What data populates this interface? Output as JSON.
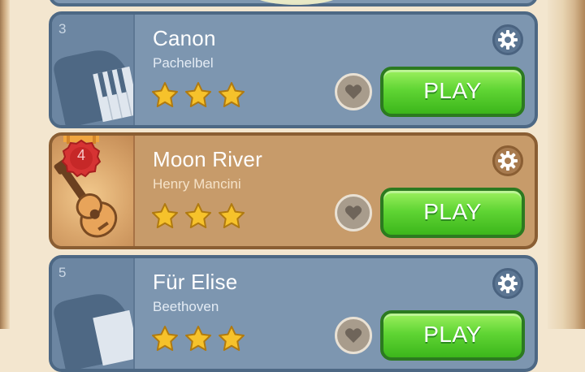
{
  "songs": [
    {
      "rank": "3",
      "title": "Canon",
      "artist": "Pachelbel",
      "stars": 3,
      "play_label": "PLAY",
      "thumb_icon": "piano-icon",
      "theme": "blue"
    },
    {
      "rank": "4",
      "title": "Moon River",
      "artist": "Henry Mancini",
      "stars": 3,
      "play_label": "PLAY",
      "thumb_icon": "guitar-icon",
      "theme": "gold"
    },
    {
      "rank": "5",
      "title": "Für Elise",
      "artist": "Beethoven",
      "stars": 3,
      "play_label": "PLAY",
      "thumb_icon": "piano-icon",
      "theme": "blue"
    }
  ],
  "colors": {
    "blue_card": "#7d96b0",
    "gold_card": "#c79b6a",
    "play_green": "#60d534",
    "star_gold": "#f6c22b",
    "medal_red": "#d32f2f"
  }
}
